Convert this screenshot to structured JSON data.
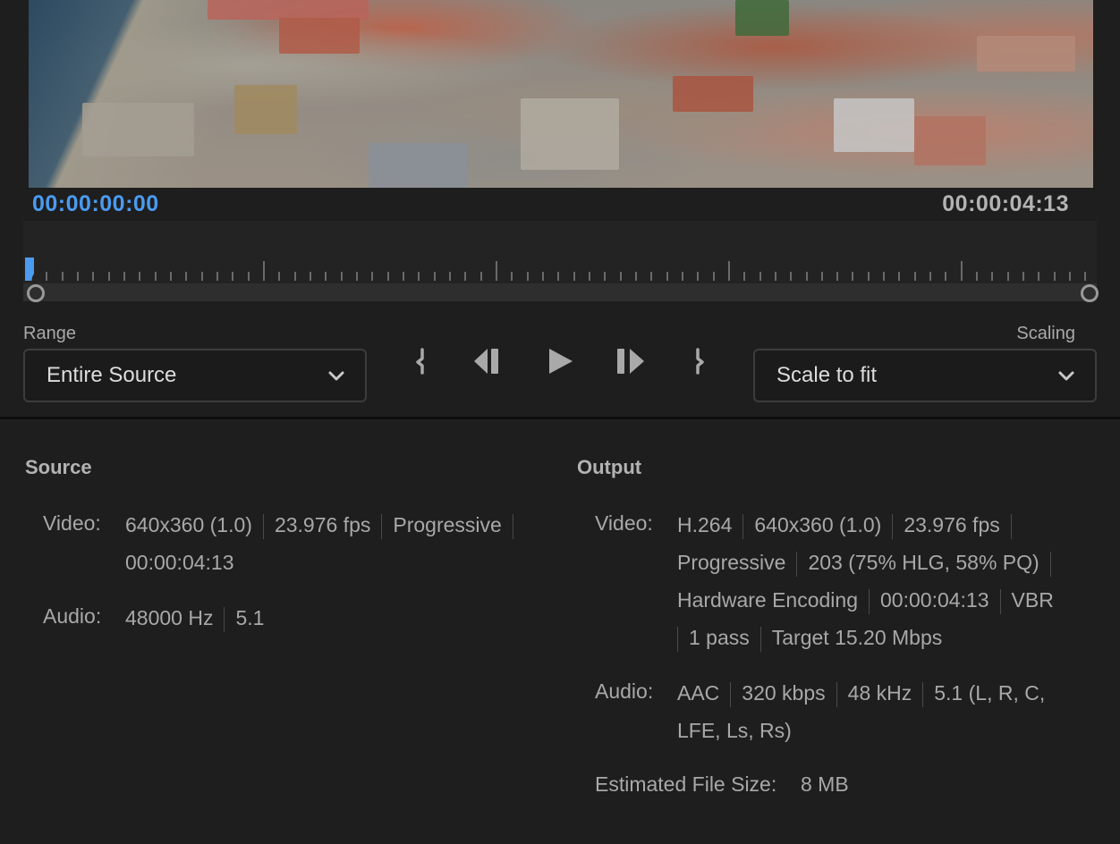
{
  "preview": {
    "image_description": "aerial view of town with rooftops and waterfront"
  },
  "timecodes": {
    "current": "00:00:00:00",
    "duration": "00:00:04:13"
  },
  "timeline": {
    "playhead_position_fraction": 0.0,
    "range_in_fraction": 0.0,
    "range_out_fraction": 1.0,
    "accent_color": "#4b9bf0"
  },
  "range": {
    "label": "Range",
    "selected": "Entire Source"
  },
  "scaling": {
    "label": "Scaling",
    "selected": "Scale to fit"
  },
  "transport": {
    "buttons": [
      {
        "name": "set-in-point",
        "icon": "in-point-bracket-icon"
      },
      {
        "name": "step-back",
        "icon": "step-back-icon"
      },
      {
        "name": "play",
        "icon": "play-icon"
      },
      {
        "name": "step-forward",
        "icon": "step-forward-icon"
      },
      {
        "name": "set-out-point",
        "icon": "out-point-bracket-icon"
      }
    ]
  },
  "source": {
    "title": "Source",
    "video_label": "Video:",
    "video_line1": [
      "640x360 (1.0)",
      "23.976 fps",
      "Progressive"
    ],
    "video_line2": "00:00:04:13",
    "audio_label": "Audio:",
    "audio": [
      "48000 Hz",
      "5.1"
    ]
  },
  "output": {
    "title": "Output",
    "video_label": "Video:",
    "video_line1": [
      "H.264",
      "640x360 (1.0)",
      "23.976 fps"
    ],
    "video_line2": [
      "Progressive",
      "203 (75% HLG, 58% PQ)"
    ],
    "video_line3": [
      "Hardware Encoding",
      "00:00:04:13",
      "VBR"
    ],
    "video_line4": [
      "1 pass",
      "Target 15.20 Mbps"
    ],
    "audio_label": "Audio:",
    "audio_line1": [
      "AAC",
      "320 kbps",
      "48 kHz",
      "5.1 (L, R, C,"
    ],
    "audio_line2": "LFE, Ls, Rs)",
    "file_size_label": "Estimated File Size:",
    "file_size_value": "8 MB"
  }
}
